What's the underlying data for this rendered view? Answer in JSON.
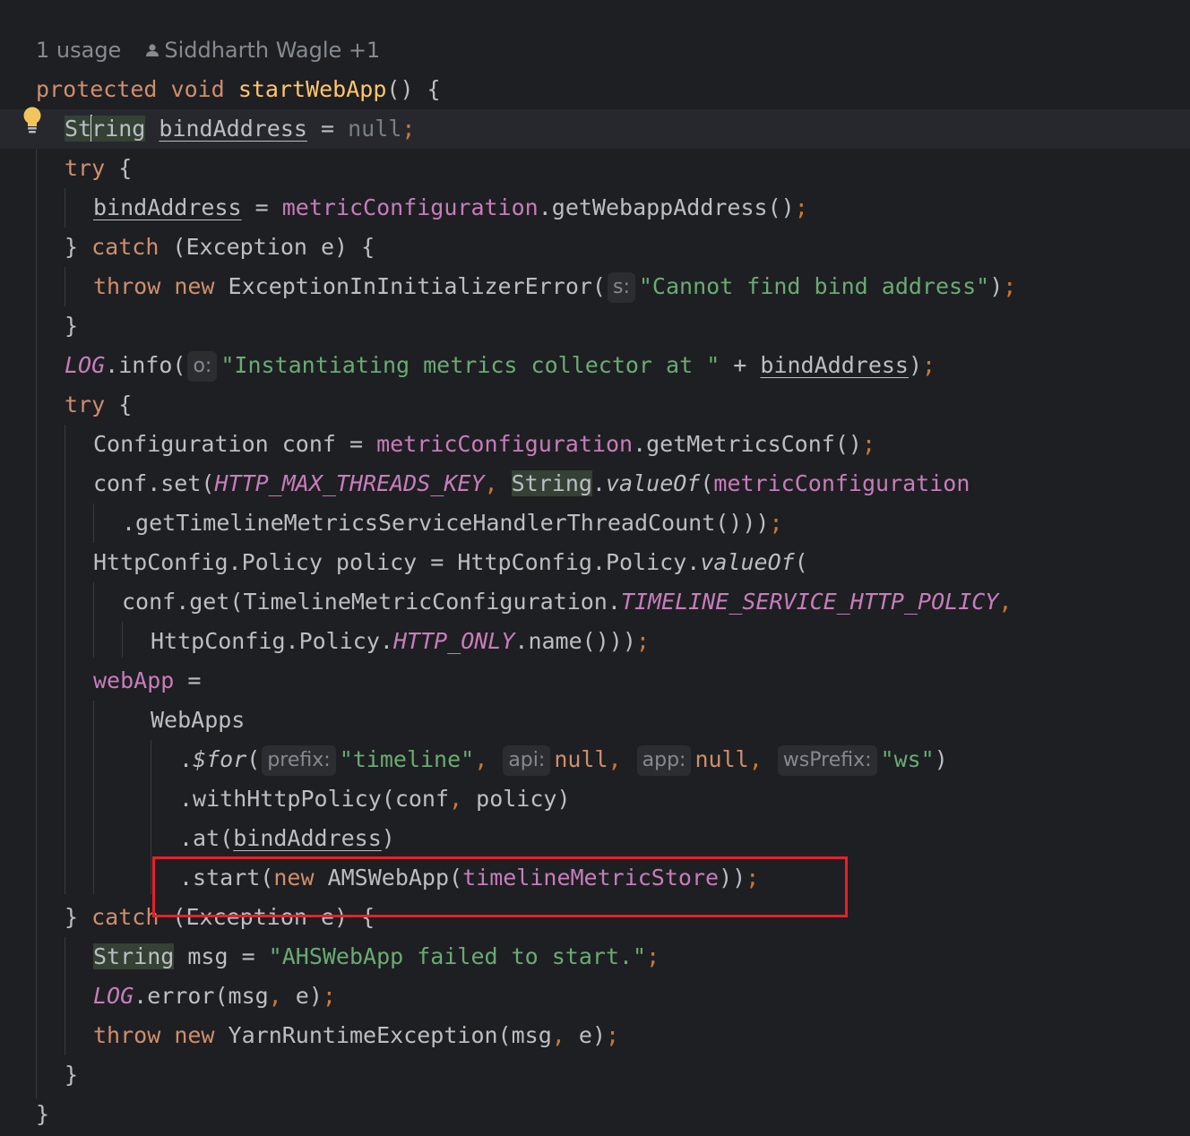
{
  "inlay_meta": {
    "usages": "1 usage",
    "authors": "Siddharth Wagle +1"
  },
  "code_lines": [
    {
      "tokens": [
        {
          "t": "protected",
          "c": "kw"
        },
        {
          "t": " "
        },
        {
          "t": "void",
          "c": "kw"
        },
        {
          "t": " "
        },
        {
          "t": "startWebApp",
          "c": "decl"
        },
        {
          "t": "() {"
        }
      ]
    },
    {
      "current": true,
      "tokens": [
        {
          "t": "St",
          "c": "hl"
        },
        {
          "caret": true
        },
        {
          "t": "ring",
          "c": "hl"
        },
        {
          "t": " "
        },
        {
          "t": "bindAddress",
          "c": "ul"
        },
        {
          "t": " = "
        },
        {
          "t": "null",
          "c": "muted"
        },
        {
          "t": ";",
          "c": "punct"
        }
      ]
    },
    {
      "tokens": [
        {
          "t": "try",
          "c": "kw"
        },
        {
          "t": " {"
        }
      ]
    },
    {
      "tokens": [
        {
          "t": "bindAddress",
          "c": "ul"
        },
        {
          "t": " = "
        },
        {
          "t": "metricConfiguration",
          "c": "fld"
        },
        {
          "t": ".getWebappAddress()"
        },
        {
          "t": ";",
          "c": "punct"
        }
      ]
    },
    {
      "tokens": [
        {
          "t": "} "
        },
        {
          "t": "catch",
          "c": "kw"
        },
        {
          "t": " (Exception e) {"
        }
      ]
    },
    {
      "tokens": [
        {
          "t": "throw",
          "c": "kw"
        },
        {
          "t": " "
        },
        {
          "t": "new",
          "c": "kw"
        },
        {
          "t": " ExceptionInInitializerError("
        },
        {
          "hint": "s:"
        },
        {
          "t": "\"Cannot find bind address\"",
          "c": "str"
        },
        {
          "t": ")"
        },
        {
          "t": ";",
          "c": "punct"
        }
      ]
    },
    {
      "tokens": [
        {
          "t": "}"
        }
      ]
    },
    {
      "tokens": [
        {
          "t": "LOG",
          "c": "fld-i"
        },
        {
          "t": ".info("
        },
        {
          "hint": "o:"
        },
        {
          "t": "\"Instantiating metrics collector at \"",
          "c": "str"
        },
        {
          "t": " + "
        },
        {
          "t": "bindAddress",
          "c": "ul"
        },
        {
          "t": ")"
        },
        {
          "t": ";",
          "c": "punct"
        }
      ]
    },
    {
      "tokens": [
        {
          "t": "try",
          "c": "kw"
        },
        {
          "t": " {"
        }
      ]
    },
    {
      "tokens": [
        {
          "t": "Configuration conf = "
        },
        {
          "t": "metricConfiguration",
          "c": "fld"
        },
        {
          "t": ".getMetricsConf()"
        },
        {
          "t": ";",
          "c": "punct"
        }
      ]
    },
    {
      "tokens": [
        {
          "t": "conf.set("
        },
        {
          "t": "HTTP_MAX_THREADS_KEY",
          "c": "fld-i"
        },
        {
          "t": ", ",
          "c": "punct"
        },
        {
          "t": "String",
          "c": "hl"
        },
        {
          "t": "."
        },
        {
          "t": "valueOf",
          "c": "italic"
        },
        {
          "t": "("
        },
        {
          "t": "metricConfiguration",
          "c": "fld"
        }
      ]
    },
    {
      "tokens": [
        {
          "t": ".getTimelineMetricsServiceHandlerThreadCount()))"
        },
        {
          "t": ";",
          "c": "punct"
        }
      ]
    },
    {
      "tokens": [
        {
          "t": "HttpConfig.Policy policy = HttpConfig.Policy."
        },
        {
          "t": "valueOf",
          "c": "italic"
        },
        {
          "t": "("
        }
      ]
    },
    {
      "tokens": [
        {
          "t": "conf.get(TimelineMetricConfiguration."
        },
        {
          "t": "TIMELINE_SERVICE_HTTP_POLICY",
          "c": "fld-i"
        },
        {
          "t": ",",
          "c": "punct"
        }
      ]
    },
    {
      "tokens": [
        {
          "t": "HttpConfig.Policy."
        },
        {
          "t": "HTTP_ONLY",
          "c": "fld-i"
        },
        {
          "t": ".name()))"
        },
        {
          "t": ";",
          "c": "punct"
        }
      ]
    },
    {
      "tokens": [
        {
          "t": "webApp",
          "c": "fld"
        },
        {
          "t": " ="
        }
      ]
    },
    {
      "tokens": [
        {
          "t": "WebApps"
        }
      ]
    },
    {
      "tokens": [
        {
          "t": "."
        },
        {
          "t": "$for",
          "c": "italic"
        },
        {
          "t": "("
        },
        {
          "hint": "prefix:"
        },
        {
          "t": "\"timeline\"",
          "c": "str"
        },
        {
          "t": ", ",
          "c": "punct"
        },
        {
          "hint": "api:"
        },
        {
          "t": "null",
          "c": "kw"
        },
        {
          "t": ", ",
          "c": "punct"
        },
        {
          "hint": "app:"
        },
        {
          "t": "null",
          "c": "kw"
        },
        {
          "t": ", ",
          "c": "punct"
        },
        {
          "hint": "wsPrefix:"
        },
        {
          "t": "\"ws\"",
          "c": "str"
        },
        {
          "t": ")"
        }
      ]
    },
    {
      "tokens": [
        {
          "t": ".withHttpPolicy(conf"
        },
        {
          "t": ", ",
          "c": "punct"
        },
        {
          "t": "policy)"
        }
      ]
    },
    {
      "tokens": [
        {
          "t": ".at("
        },
        {
          "t": "bindAddress",
          "c": "ul"
        },
        {
          "t": ")"
        }
      ]
    },
    {
      "tokens": [
        {
          "t": ".start("
        },
        {
          "t": "new",
          "c": "kw"
        },
        {
          "t": " AMSWebApp("
        },
        {
          "t": "timelineMetricStore",
          "c": "fld"
        },
        {
          "t": "))"
        },
        {
          "t": ";",
          "c": "punct"
        }
      ]
    },
    {
      "tokens": [
        {
          "t": "} "
        },
        {
          "t": "catch",
          "c": "kw"
        },
        {
          "t": " (Exception e) {"
        }
      ]
    },
    {
      "tokens": [
        {
          "t": "String",
          "c": "hl"
        },
        {
          "t": " msg = "
        },
        {
          "t": "\"AHSWebApp failed to start.\"",
          "c": "str"
        },
        {
          "t": ";",
          "c": "punct"
        }
      ]
    },
    {
      "tokens": [
        {
          "t": "LOG",
          "c": "fld-i"
        },
        {
          "t": ".error(msg"
        },
        {
          "t": ", ",
          "c": "punct"
        },
        {
          "t": "e)"
        },
        {
          "t": ";",
          "c": "punct"
        }
      ]
    },
    {
      "tokens": [
        {
          "t": "throw",
          "c": "kw"
        },
        {
          "t": " "
        },
        {
          "t": "new",
          "c": "kw"
        },
        {
          "t": " YarnRuntimeException(msg"
        },
        {
          "t": ", ",
          "c": "punct"
        },
        {
          "t": "e)"
        },
        {
          "t": ";",
          "c": "punct"
        }
      ]
    },
    {
      "tokens": [
        {
          "t": "}"
        }
      ]
    },
    {
      "tokens": [
        {
          "t": "}"
        }
      ]
    }
  ],
  "icons": {
    "person": "person-icon",
    "intention_bulb": "lightbulb-icon"
  },
  "theme": {
    "background": "#1e1f22",
    "current_line": "#26282e",
    "keyword": "#cf8e6d",
    "string": "#6aab73",
    "field": "#c77dbb",
    "method_decl": "#ffc66d",
    "highlight_box": "#e8202a"
  }
}
